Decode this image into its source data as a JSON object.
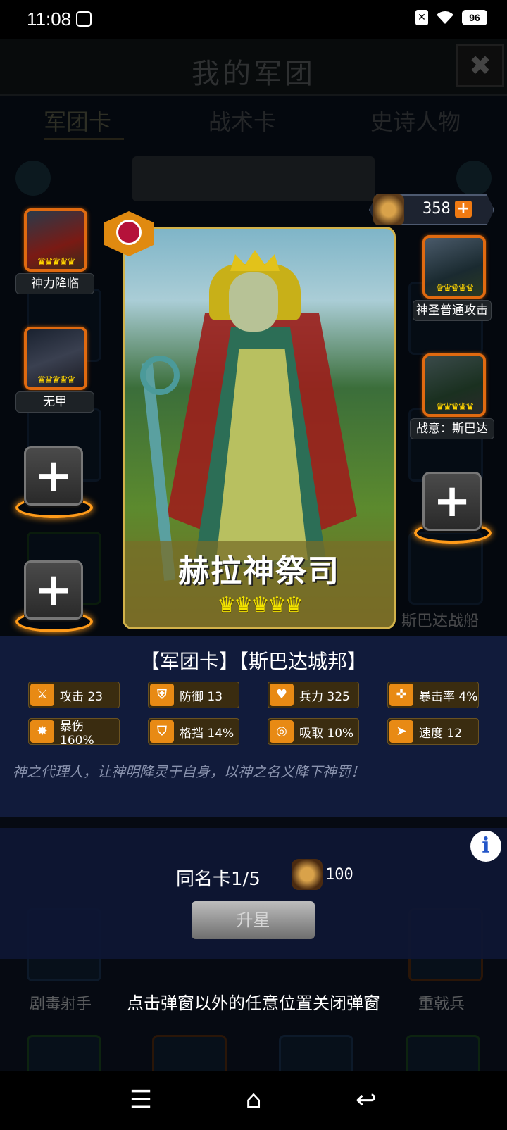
{
  "status_bar": {
    "time": "11:08",
    "battery": "96",
    "sim": "✕"
  },
  "header": {
    "title": "我的军团",
    "close_icon": "✖"
  },
  "tabs": [
    {
      "label": "军团卡"
    },
    {
      "label": "战术卡"
    },
    {
      "label": "史诗人物"
    }
  ],
  "background_labels": [
    "剧毒射手",
    "重戟兵",
    "斯巴达战船"
  ],
  "currency": {
    "value": "358",
    "add": "+"
  },
  "left_slots": [
    {
      "label": "神力降临",
      "filled": true
    },
    {
      "label": "无甲",
      "filled": true
    },
    {
      "label": "",
      "filled": false
    },
    {
      "label": "",
      "filled": false
    }
  ],
  "right_slots": [
    {
      "label": "神圣普通攻击",
      "filled": true
    },
    {
      "label": "战意：斯巴达",
      "filled": true
    },
    {
      "label": "",
      "filled": false
    }
  ],
  "hero": {
    "name": "赫拉神祭司",
    "stars": "♛♛♛♛♛"
  },
  "card": {
    "type_line": "【军团卡】【斯巴达城邦】",
    "stats": [
      {
        "label": "攻击 23",
        "icon": "sword-icon"
      },
      {
        "label": "防御 13",
        "icon": "shield-icon"
      },
      {
        "label": "兵力 325",
        "icon": "heart-icon"
      },
      {
        "label": "暴击率 4%",
        "icon": "crosshair-icon"
      },
      {
        "label": "暴伤 160%",
        "icon": "burst-icon"
      },
      {
        "label": "格挡 14%",
        "icon": "block-icon"
      },
      {
        "label": "吸取 10%",
        "icon": "drain-icon"
      },
      {
        "label": "速度 12",
        "icon": "boot-icon"
      }
    ],
    "flavor": "神之代理人，让神明降灵于自身，以神之名义降下神罚！"
  },
  "upgrade": {
    "dup_text": "同名卡1/5",
    "cost": "100",
    "button": "升星",
    "info_icon": "i"
  },
  "hint": "点击弹窗以外的任意位置关闭弹窗",
  "nav": {
    "menu": "☰",
    "home": "⌂",
    "back": "↩"
  },
  "colors": {
    "accent_orange": "#e88a14",
    "panel_blue": "#121c3e",
    "star_yellow": "#f3e400"
  }
}
